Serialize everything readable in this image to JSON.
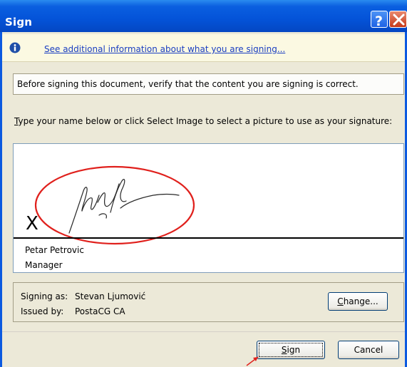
{
  "window": {
    "title": "Sign",
    "help_glyph": "?",
    "close_glyph": "✕"
  },
  "infobar": {
    "icon": "info-icon",
    "link_text": "See additional information about what you are signing..."
  },
  "verify_text": "Before signing this document, verify that the content you are signing is correct.",
  "instruction": {
    "mnemonic": "T",
    "rest": "ype your name below or click Select Image to select a picture to use as your signature:"
  },
  "signature": {
    "x_mark": "X",
    "signer_name": "Petar Petrovic",
    "signer_title": "Manager",
    "highlight_color": "#e0201c"
  },
  "signing_info": {
    "signing_as_label": "Signing as:",
    "signing_as_value": "Stevan Ljumović",
    "issued_by_label": "Issued by:",
    "issued_by_value": "PostaCG CA"
  },
  "buttons": {
    "change_mnemonic": "C",
    "change_rest": "hange...",
    "sign_mnemonic": "S",
    "sign_rest": "ign",
    "cancel": "Cancel"
  }
}
